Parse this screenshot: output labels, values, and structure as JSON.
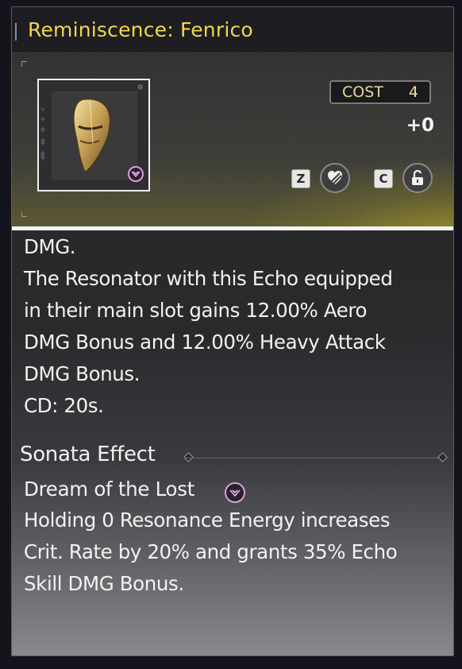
{
  "header": {
    "title": "Reminiscence: Fenrico"
  },
  "echo": {
    "cost_label": "COST",
    "cost_value": "4",
    "level": "+0",
    "lock_key": "Z",
    "lock_icon": "heart-slash-icon",
    "discard_key": "C",
    "discard_icon": "unlock-icon",
    "sonata_icon": "sonata-crest-icon",
    "accent_color": "#f2d74a",
    "sonata_color": "#d7a1d6"
  },
  "skill": {
    "description": "DMG.\nThe Resonator with this Echo equipped\nin their main slot gains 12.00% Aero\nDMG Bonus and 12.00% Heavy Attack\nDMG Bonus.\nCD: 20s."
  },
  "sonata": {
    "heading": "Sonata Effect",
    "set_name": "Dream of the Lost",
    "set_description": "Holding 0 Resonance Energy increases\nCrit. Rate by 20% and grants 35% Echo\nSkill DMG Bonus."
  }
}
